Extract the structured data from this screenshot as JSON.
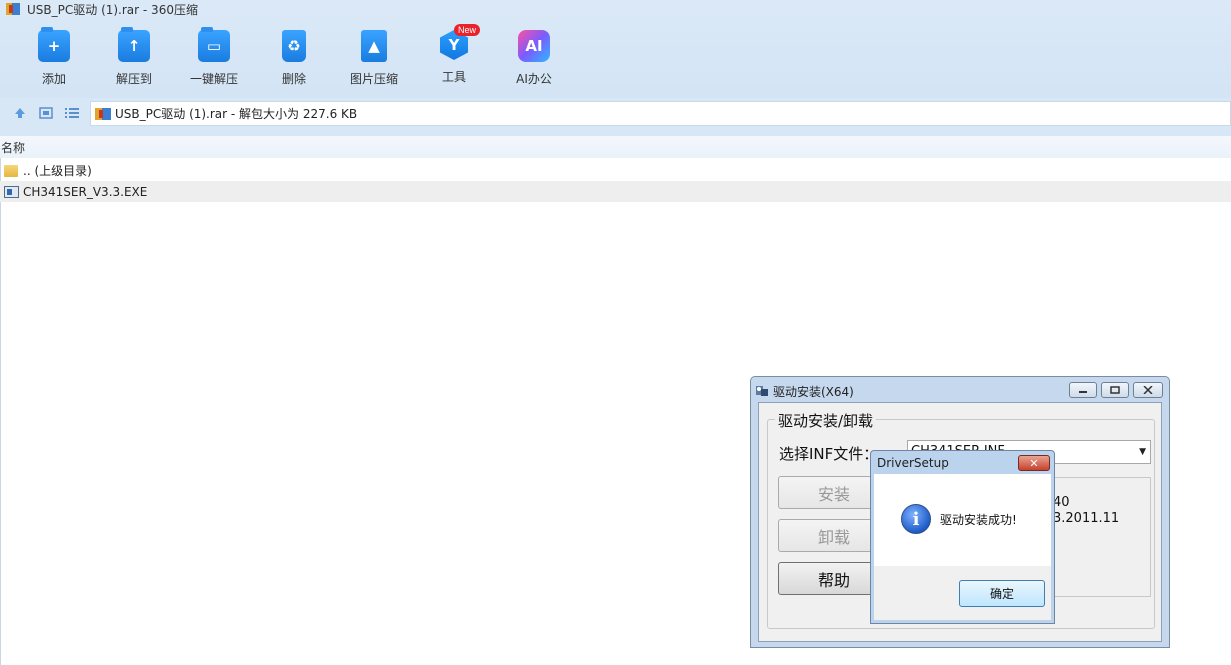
{
  "window": {
    "title": "USB_PC驱动 (1).rar - 360压缩"
  },
  "toolbar": {
    "items": [
      {
        "label": "添加",
        "icon": "add-icon"
      },
      {
        "label": "解压到",
        "icon": "extract-to-icon"
      },
      {
        "label": "一键解压",
        "icon": "one-click-extract-icon"
      },
      {
        "label": "删除",
        "icon": "delete-icon"
      },
      {
        "label": "图片压缩",
        "icon": "image-compress-icon"
      },
      {
        "label": "工具",
        "icon": "tools-icon",
        "badge": "New"
      },
      {
        "label": "AI办公",
        "icon": "ai-office-icon",
        "icon_text": "AI"
      }
    ]
  },
  "address": {
    "text": "USB_PC驱动 (1).rar - 解包大小为 227.6 KB"
  },
  "list": {
    "column_name": "名称",
    "rows": [
      {
        "name": ".. (上级目录)",
        "type": "folder"
      },
      {
        "name": "CH341SER_V3.3.EXE",
        "type": "exe",
        "selected": true
      }
    ]
  },
  "driver_window": {
    "title": "驱动安装(X64)",
    "group_label": "驱动安装/卸载",
    "inf_label": "选择INF文件：",
    "inf_value": "CH341SER.INF",
    "buttons": {
      "install": "安装",
      "uninstall": "卸载",
      "help": "帮助"
    },
    "info_line1": "40",
    "info_line2": "3.2011.11"
  },
  "message_box": {
    "title": "DriverSetup",
    "close_glyph": "✕",
    "icon_glyph": "i",
    "message": "驱动安装成功!",
    "ok_label": "确定"
  },
  "colors": {
    "toolbar_bg": "#d3e4f5",
    "accent_blue": "#1a7ce0",
    "badge_red": "#e8232b",
    "selection": "#eeeeee"
  }
}
